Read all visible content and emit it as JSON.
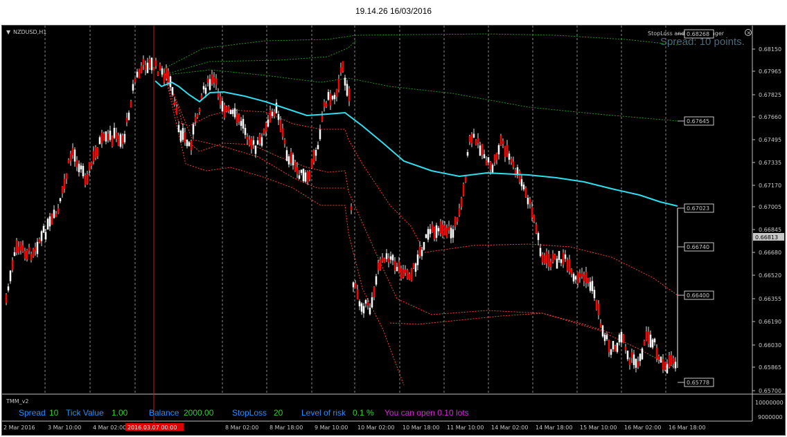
{
  "window": {
    "title": "19.14.26 16/03/2016"
  },
  "chart": {
    "symbol_label": "NZDUSD,H1",
    "spread_overlay": "Spread: 10 points.",
    "ea_label": "StopLoss and Risk Manager",
    "price_scale": [
      "0.68150",
      "0.67965",
      "0.67825",
      "0.67660",
      "0.67495",
      "0.67335",
      "0.67170",
      "0.67005",
      "0.66845",
      "0.66680",
      "0.66520",
      "0.66355",
      "0.66190",
      "0.66030",
      "0.65865",
      "0.65700"
    ],
    "current_price": "0.66813",
    "level_labels": [
      "0.68268",
      "0.67645",
      "0.67023",
      "0.66740",
      "0.66400",
      "0.65778"
    ],
    "time_labels": [
      "2 Mar 2016",
      "3 Mar 10:00",
      "4 Mar 02:00",
      "7 Mar 10:00",
      "8 Mar 02:00",
      "8 Mar 18:00",
      "9 Mar 10:00",
      "10 Mar 02:00",
      "10 Mar 18:00",
      "11 Mar 10:00",
      "14 Mar 02:00",
      "14 Mar 18:00",
      "15 Mar 10:00",
      "16 Mar 02:00",
      "16 Mar 18:00"
    ],
    "cursor_time": "2016.03.07 00:00",
    "colors": {
      "background": "#000000",
      "candle": "#ff0000",
      "wick": "#ffffff",
      "ma_line": "#2fe0f0",
      "green_bands": "#1a9a1a",
      "red_bands": "#ff3a3a"
    }
  },
  "indicator": {
    "name": "TMM_v2",
    "spread_label": "Spread",
    "spread_value": "10",
    "tick_label": "Tick Value",
    "tick_value": "1.00",
    "balance_label": "Balance",
    "balance_value": "2000.00",
    "stoploss_label": "StopLoss",
    "stoploss_value": "20",
    "risk_label": "Level of risk",
    "risk_value": "0.1 %",
    "lots_text": "You can open 0.10 lots",
    "scale": [
      "10000000",
      "9000000"
    ]
  }
}
